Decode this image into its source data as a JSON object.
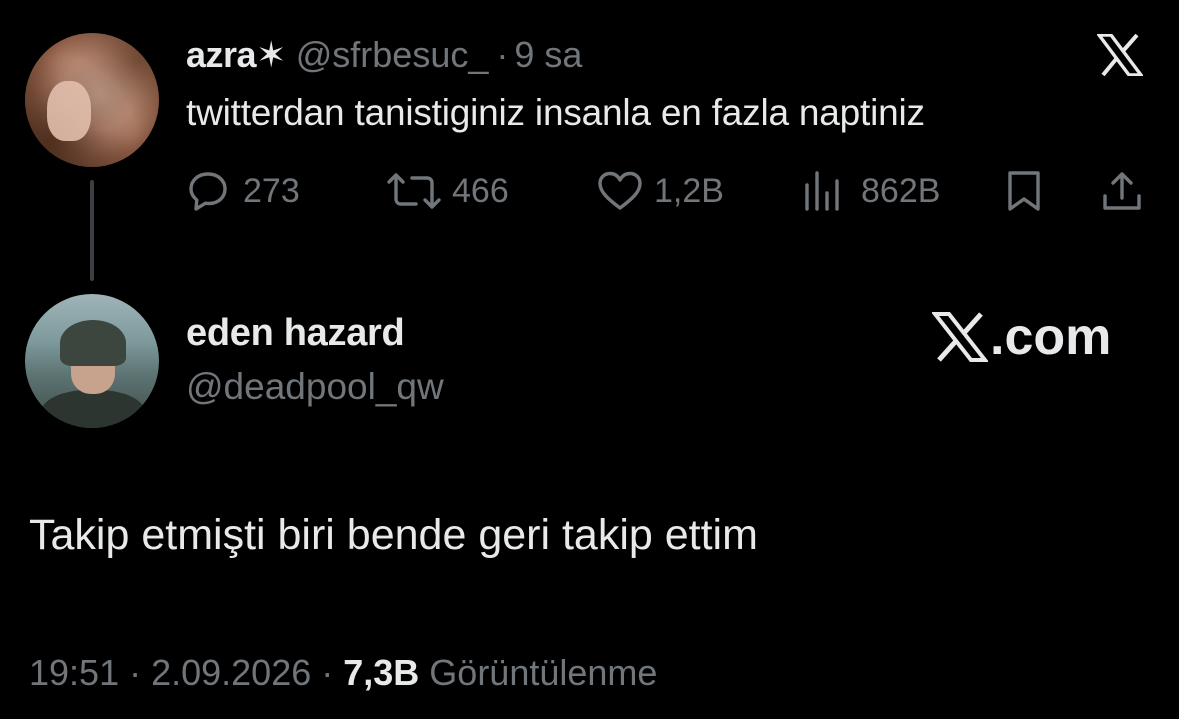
{
  "parent_tweet": {
    "display_name": "azra",
    "name_symbol": "✶",
    "handle": "@sfrbesuc_",
    "separator": "·",
    "time": "9 sa",
    "platform_icon": "x-logo-icon",
    "text": "twitterdan tanistiginiz insanla en fazla naptiniz",
    "actions": {
      "replies": "273",
      "reposts": "466",
      "likes": "1,2B",
      "views": "862B"
    }
  },
  "reply": {
    "display_name": "eden hazard",
    "handle": "@deadpool_qw",
    "brand_suffix": ".com",
    "text": "Takip etmişti biri bende geri takip ettim",
    "time": "19:51",
    "separator": "·",
    "date": "2.09.2026",
    "views_count": "7,3B",
    "views_label": "Görüntülenme"
  },
  "colors": {
    "background": "#000000",
    "primary_text": "#e7e9ea",
    "secondary_text": "#71767b",
    "thread_line": "#3b3f44"
  }
}
